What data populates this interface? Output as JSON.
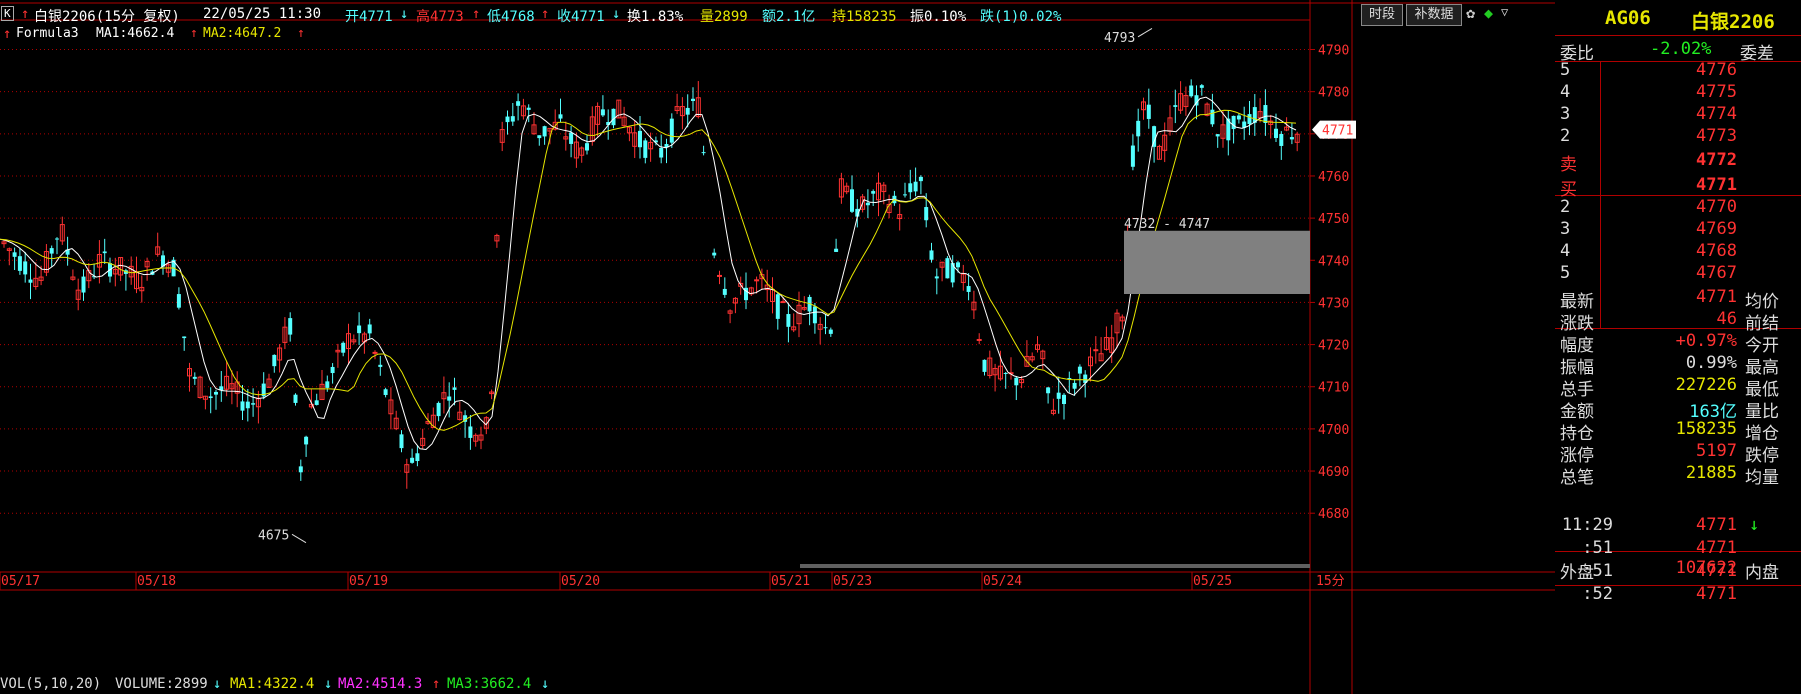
{
  "header": {
    "indicator_box": "K",
    "arrow": "↑",
    "symbol": "白银2206(15分 复权)",
    "datetime": "22/05/25 11:30",
    "open": "开4771",
    "open_arrow": "↓",
    "high": "高4773",
    "high_arrow": "↑",
    "low": "低4768",
    "low_arrow": "↑",
    "close": "收4771",
    "close_arrow": "↓",
    "turnover": "换1.83%",
    "volume": "量2899",
    "amount": "额2.1亿",
    "hold": "持158235",
    "amplitude": "振0.10%",
    "fall": "跌(1)0.02%",
    "btn_time": "时段",
    "btn_fill": "补数据"
  },
  "formula": {
    "arrow": "↑",
    "name": "Formula3",
    "ma1": "MA1:4662.4",
    "ma1_arrow": "↑",
    "ma2": "MA2:4647.2",
    "ma2_arrow": "↑"
  },
  "chart_data": {
    "type": "candlestick",
    "interval": "15分",
    "y_ticks": [
      4680,
      4690,
      4700,
      4710,
      4720,
      4730,
      4740,
      4750,
      4760,
      4770,
      4780,
      4790
    ],
    "ylim": [
      4667,
      4797
    ],
    "current_price": "4771",
    "x_labels": [
      "05/17",
      "05/18",
      "05/19",
      "05/20",
      "05/21",
      "05/23",
      "05/24",
      "05/25"
    ],
    "x_unit": "15分",
    "annotations": [
      "4793",
      "4675",
      "4732 - 4747"
    ],
    "zone": [
      4732,
      4747
    ],
    "colors": {
      "up": "#ff3232",
      "down": "#54ffff",
      "ma1": "#ffffff",
      "ma2": "#e6e600",
      "zone": "#808080"
    }
  },
  "panel": {
    "code": "AG06",
    "name": "白银2206",
    "wb_label": "委比",
    "wb_value": "-2.02%",
    "wc_label": "委差",
    "asks": [
      {
        "level": "5",
        "price": "4776"
      },
      {
        "level": "4",
        "price": "4775"
      },
      {
        "level": "3",
        "price": "4774"
      },
      {
        "level": "2",
        "price": "4773"
      },
      {
        "level": "卖",
        "price": "4772"
      }
    ],
    "bids": [
      {
        "level": "买",
        "price": "4771"
      },
      {
        "level": "2",
        "price": "4770"
      },
      {
        "level": "3",
        "price": "4769"
      },
      {
        "level": "4",
        "price": "4768"
      },
      {
        "level": "5",
        "price": "4767"
      }
    ],
    "stats": [
      {
        "label": "最新",
        "value": "4771",
        "label2": "均价",
        "color": "#ff3232"
      },
      {
        "label": "涨跌",
        "value": "46",
        "label2": "前结",
        "color": "#ff3232"
      },
      {
        "label": "幅度",
        "value": "+0.97%",
        "label2": "今开",
        "color": "#ff3232"
      },
      {
        "label": "振幅",
        "value": "0.99%",
        "label2": "最高",
        "color": "#dddddd"
      },
      {
        "label": "总手",
        "value": "227226",
        "label2": "最低",
        "color": "#e6e600"
      },
      {
        "label": "金额",
        "value": "163亿",
        "label2": "量比",
        "color": "#54ffff"
      },
      {
        "label": "持仓",
        "value": "158235",
        "label2": "增仓",
        "color": "#e6e600"
      },
      {
        "label": "涨停",
        "value": "5197",
        "label2": "跌停",
        "color": "#ff3232"
      },
      {
        "label": "总笔",
        "value": "21885",
        "label2": "均量",
        "color": "#e6e600"
      }
    ],
    "outer_label": "外盘",
    "outer_value": "107622",
    "inner_label": "内盘",
    "ticks": [
      {
        "time": "11:29",
        "price": "4771",
        "arrow": "↓"
      },
      {
        "time": ":51",
        "price": "4771",
        "arrow": ""
      },
      {
        "time": ":51",
        "price": "4771",
        "arrow": ""
      },
      {
        "time": ":52",
        "price": "4771",
        "arrow": ""
      }
    ]
  },
  "volume_bar": {
    "name": "VOL(5,10,20)",
    "volume": "VOLUME:2899",
    "volume_arrow": "↓",
    "ma1": "MA1:4322.4",
    "ma1_arrow": "↓",
    "ma2": "MA2:4514.3",
    "ma2_arrow": "↑",
    "ma3": "MA3:3662.4",
    "ma3_arrow": "↓"
  }
}
